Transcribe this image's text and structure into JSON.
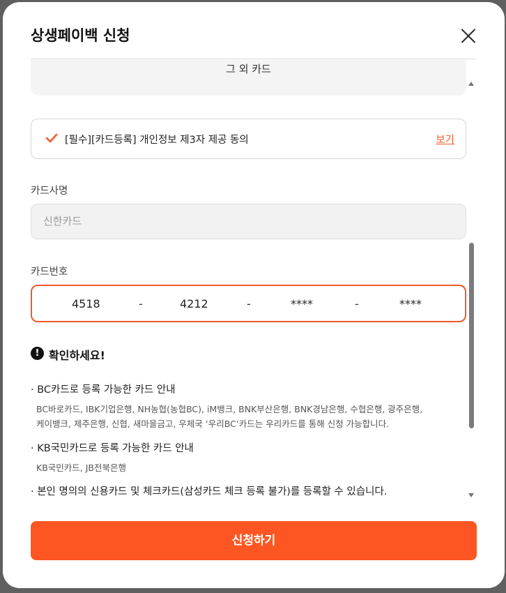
{
  "modal": {
    "title": "상생페이백 신청",
    "close_icon": "close-icon"
  },
  "card_select": {
    "label": "그 외 카드"
  },
  "agreement": {
    "text": "[필수][카드등록] 개인정보 제3자 제공 동의",
    "view_link": "보기",
    "checked": true,
    "check_color": "#f05a28"
  },
  "card_name": {
    "label": "카드사명",
    "placeholder": "신한카드"
  },
  "card_number": {
    "label": "카드번호",
    "parts": [
      "4518",
      "4212",
      "****",
      "****"
    ],
    "separator": "-"
  },
  "notice": {
    "icon": "exclamation-icon",
    "title": "확인하세요!",
    "sections": [
      {
        "heading": "· BC카드로 등록 가능한 카드 안내",
        "body_lines": [
          "BC바로카드, IBK기업은행, NH농협(농협BC), iM뱅크, BNK부산은행, BNK경남은행, 수협은행, 광주은행,",
          "케이뱅크, 제주은행, 신협, 새마을금고, 우체국 ‘우리BC’카드는 우리카드를 통해 신청 가능합니다."
        ]
      },
      {
        "heading": "· KB국민카드로 등록 가능한 카드 안내",
        "body_lines": [
          "KB국민카드, JB전북은행"
        ]
      },
      {
        "heading": "· 본인 명의의 신용카드 및 체크카드(삼성카드 체크 등록 불가)를 등록할 수 있습니다.",
        "body_lines": []
      }
    ]
  },
  "submit": {
    "label": "신청하기",
    "color": "#fd5622"
  },
  "colors": {
    "accent": "#f05a28",
    "overlay": "#5f5f5f"
  }
}
